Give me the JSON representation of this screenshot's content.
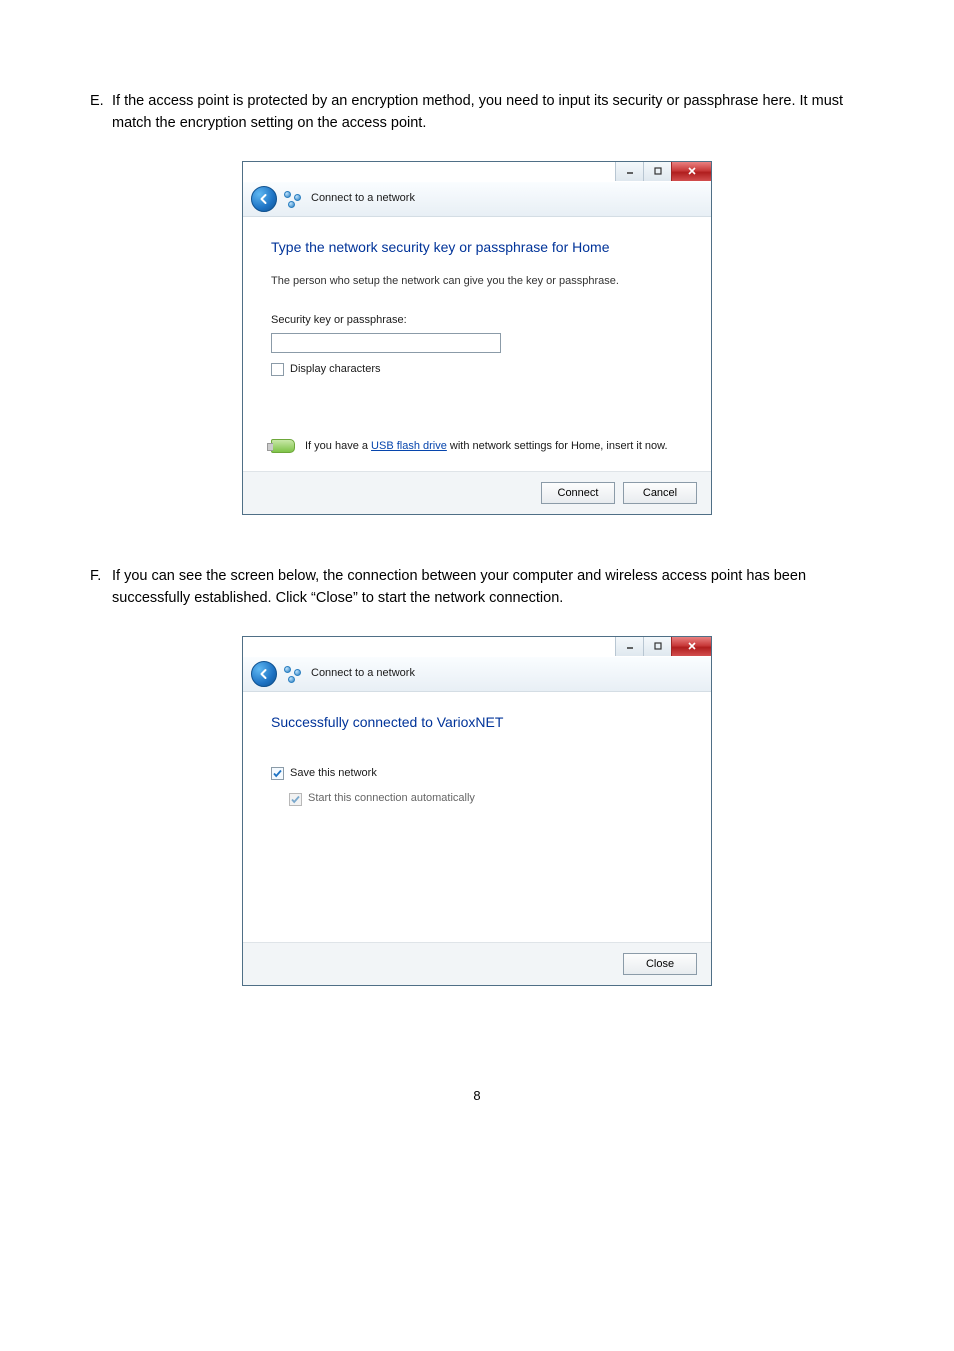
{
  "paragraphs": {
    "e": {
      "marker": "E.",
      "text": "If the access point is protected by an encryption method, you need to input its security or passphrase here. It must match the encryption setting on the access point."
    },
    "f": {
      "marker": "F.",
      "text": "If you can see the screen below, the connection between your computer and wireless access point has been successfully established. Click “Close” to start the network connection."
    }
  },
  "dialog1": {
    "header_title": "Connect to a network",
    "heading": "Type the network security key or passphrase for Home",
    "subheading": "The person who setup the network can give you the key or passphrase.",
    "field_label": "Security key or passphrase:",
    "input_value": "",
    "display_chars_label": "Display characters",
    "display_chars_checked": false,
    "hint_prefix": "If you have a ",
    "hint_link": "USB flash drive",
    "hint_suffix": " with network settings for Home, insert it now.",
    "connect_btn": "Connect",
    "cancel_btn": "Cancel"
  },
  "dialog2": {
    "header_title": "Connect to a network",
    "heading": "Successfully connected to VarioxNET",
    "save_network_label": "Save this network",
    "save_network_checked": true,
    "start_auto_label": "Start this connection automatically",
    "start_auto_checked": true,
    "close_btn": "Close"
  },
  "page_number": "8"
}
